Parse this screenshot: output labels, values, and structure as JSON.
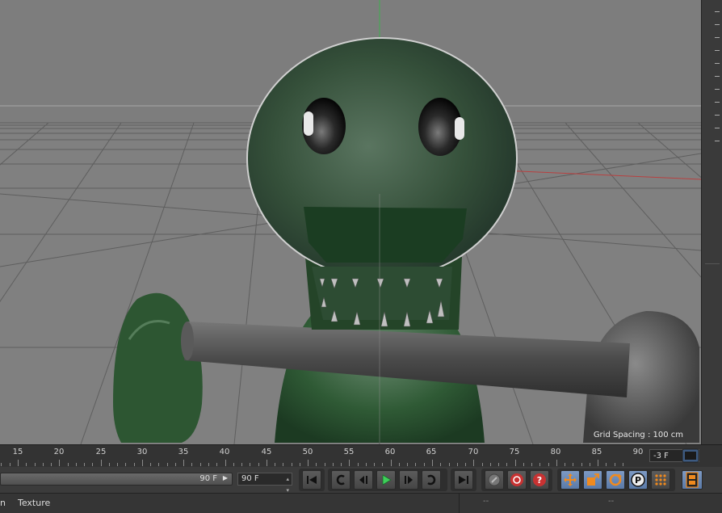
{
  "viewport": {
    "grid_spacing_label": "Grid Spacing : 100 cm",
    "background_color": "#7e7e7e",
    "character_color": "#2f4a33"
  },
  "timeline": {
    "ticks": [
      "15",
      "20",
      "25",
      "30",
      "35",
      "40",
      "45",
      "50",
      "55",
      "60",
      "65",
      "70",
      "75",
      "80",
      "85",
      "90"
    ],
    "current_frame": "-3 F"
  },
  "transport": {
    "range_slider_value": "90 F",
    "end_frame": "90 F"
  },
  "statusbar": {
    "left_text": "n",
    "material_tab": "Texture",
    "right_fields": [
      "--",
      "--"
    ]
  },
  "icons": {
    "go-start": "go-to-start-icon",
    "prev-key": "previous-keyframe-icon",
    "step-back": "step-back-icon",
    "play": "play-forward-icon",
    "step-forward": "step-forward-icon",
    "next-key": "next-keyframe-icon",
    "go-end": "go-to-end-icon",
    "record": "record-active-icon",
    "autokey": "autokey-icon",
    "keyhelp": "key-help-icon",
    "move": "move-key-icon",
    "scale": "scale-key-icon",
    "rotate": "rotate-key-icon",
    "param": "parameter-key-icon",
    "pla": "point-level-animation-icon",
    "timeline-open": "timeline-open-icon"
  }
}
